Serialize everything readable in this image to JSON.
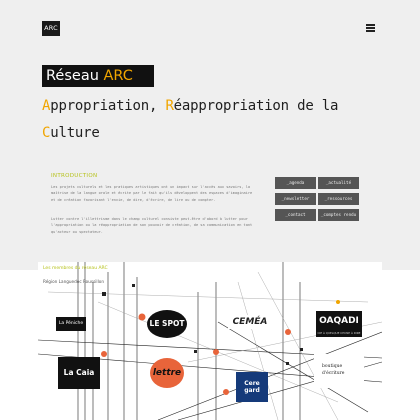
{
  "header": {
    "logo_text": "ARC",
    "menu_icon": "hamburger-menu-icon"
  },
  "hero": {
    "title_prefix": "Réseau ",
    "title_accent": "ARC",
    "subtitle_lines": [
      {
        "cap": "A",
        "rest": "ppropriation, "
      },
      {
        "cap": "R",
        "rest": "éappropriation de la"
      },
      {
        "cap": "C",
        "rest": "ulture"
      }
    ]
  },
  "intro": {
    "heading": "INTRODUCTION",
    "paragraph_1": "Les projets culturels et les pratiques artistiques ont un impact sur l'accès aux savoirs, la maîtrise de la langue orale et écrite par le fait qu'ils développent des espaces d'imaginaire et de création favorisant l'envie, de dire, d'écrire, de lire ou de compter.",
    "paragraph_2": "Lutter contre l'illettrisme dans le champ culturel consiste peut-être d'abord à lutter pour l'appropriation ou la réappropriation de son pouvoir de création, de sa communication en tant qu'acteur ou spectateur."
  },
  "nav_buttons": {
    "agenda": "_agenda",
    "actualite": "_actualité",
    "newsletter": "_newsletter",
    "ressources": "_ressources",
    "contact": "_contact",
    "comptes_rendu": "_comptes rendu"
  },
  "map": {
    "heading": "Les membres du réseau ARC",
    "region": "Région Languedoc Roussillon",
    "partners": {
      "peniche": "La Péniche",
      "spot": "LE SPOT",
      "cemea": "CEMÉA",
      "oaqadi": "OAQADI",
      "oaqadi_tagline": "CIE À QUELQUE CHOSE À DIRE",
      "lacaia": "La Caia",
      "lettre": "lettre",
      "ceregard": "Cere gard",
      "boutique": "boutique d'écriture"
    }
  },
  "colors": {
    "accent": "#f0a500",
    "intro_heading": "#b6c21a",
    "hero_background": "#efefef",
    "button_background": "#555555"
  }
}
